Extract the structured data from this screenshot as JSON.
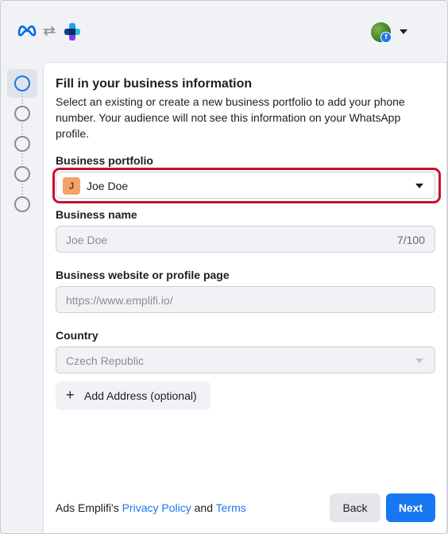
{
  "header": {
    "logo_icon": "meta-logo-icon",
    "switch_icon": "swap-arrows-icon",
    "app_icon": "whatsapp-business-icon",
    "account_badge": "f",
    "colors": {
      "meta_blue": "#0668E1",
      "fb_blue": "#1877f2"
    }
  },
  "steps": {
    "count": 5,
    "active_index": 0
  },
  "form": {
    "title": "Fill in your business information",
    "description": "Select an existing or create a new business portfolio to add your phone number. Your audience will not see this information on your WhatsApp profile.",
    "portfolio": {
      "label": "Business portfolio",
      "initial": "J",
      "value": "Joe Doe"
    },
    "business_name": {
      "label": "Business name",
      "value": "Joe Doe",
      "counter": "7/100"
    },
    "website": {
      "label": "Business website or profile page",
      "value": "https://www.emplifi.io/"
    },
    "country": {
      "label": "Country",
      "value": "Czech Republic"
    },
    "add_address": {
      "plus": "+",
      "label": "Add Address (optional)"
    }
  },
  "footer": {
    "prefix": "Ads Emplifi's ",
    "privacy_link": "Privacy Policy",
    "conjunction": " and ",
    "terms_link": "Terms",
    "back_label": "Back",
    "next_label": "Next"
  },
  "colors": {
    "highlight": "#c8102e",
    "primary": "#1877f2",
    "portfolio_avatar": "#f4a26b"
  }
}
